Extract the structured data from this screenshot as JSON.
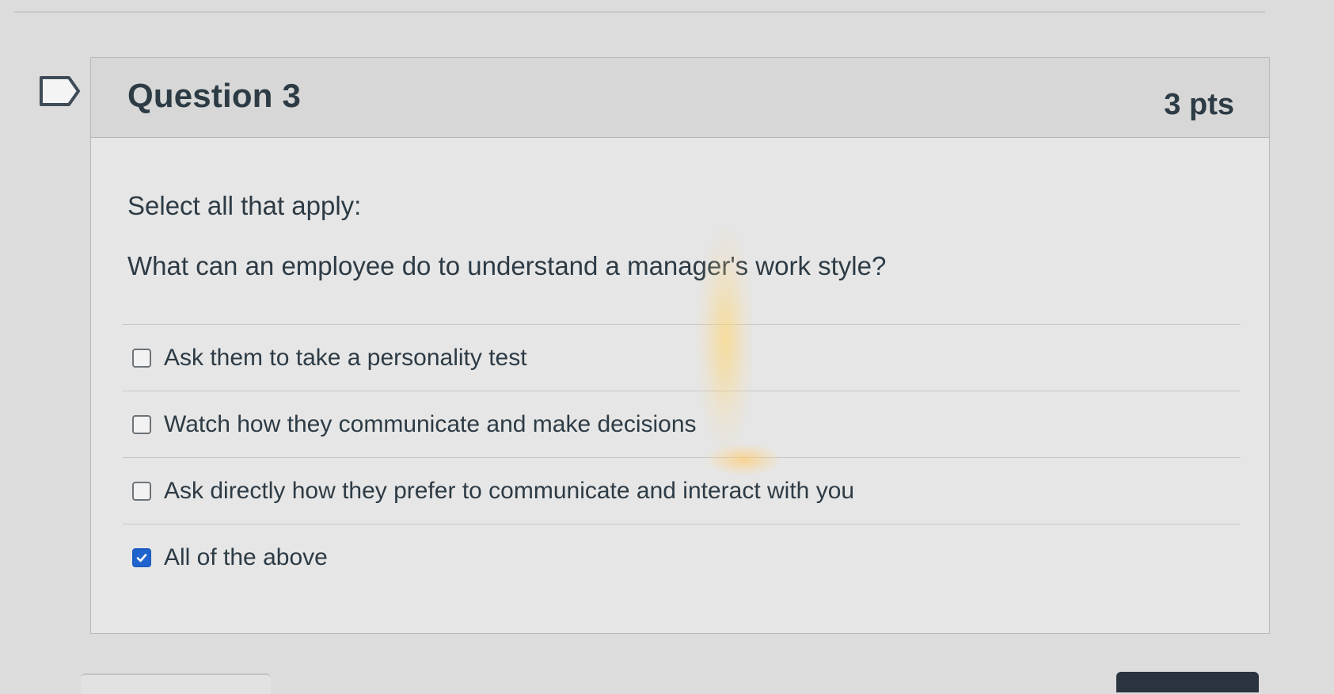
{
  "question": {
    "title": "Question 3",
    "points": "3 pts",
    "instruction": "Select all that apply:",
    "prompt": "What can an employee do to understand a manager's work style?",
    "answers": [
      {
        "label": "Ask them to take a personality test",
        "checked": false
      },
      {
        "label": "Watch how they communicate and make decisions",
        "checked": false
      },
      {
        "label": "Ask directly how they prefer to communicate and interact with you",
        "checked": false
      },
      {
        "label": "All of the above",
        "checked": true
      }
    ]
  },
  "icons": {
    "flag": "flag-outline-icon",
    "checkbox_checked": "checkmark-icon"
  },
  "colors": {
    "text": "#2d3b45",
    "checked_accent": "#1f63cf",
    "card_header": "#d7d7d7",
    "card_body": "#e6e6e6"
  }
}
